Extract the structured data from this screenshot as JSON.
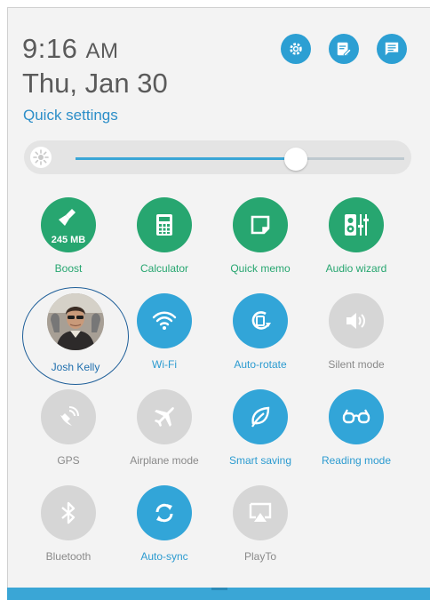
{
  "header": {
    "time": "9:16",
    "ampm": "AM",
    "date": "Thu, Jan 30",
    "quick_settings_label": "Quick settings"
  },
  "top_icons": [
    "gear-icon",
    "edit-icon",
    "message-icon"
  ],
  "brightness": {
    "level_percent": 67
  },
  "tiles": [
    {
      "label": "Boost",
      "sub": "245 MB",
      "state": "on",
      "icon": "broom-icon"
    },
    {
      "label": "Calculator",
      "state": "on",
      "icon": "calculator-icon"
    },
    {
      "label": "Quick memo",
      "state": "on",
      "icon": "memo-icon"
    },
    {
      "label": "Audio wizard",
      "state": "on",
      "icon": "audio-wizard-icon"
    },
    {
      "label": "Josh Kelly",
      "state": "user",
      "icon": "avatar"
    },
    {
      "label": "Wi-Fi",
      "state": "on",
      "icon": "wifi-icon"
    },
    {
      "label": "Auto-rotate",
      "state": "on",
      "icon": "auto-rotate-icon"
    },
    {
      "label": "Silent mode",
      "state": "off",
      "icon": "speaker-icon"
    },
    {
      "label": "GPS",
      "state": "off",
      "icon": "gps-icon"
    },
    {
      "label": "Airplane mode",
      "state": "off",
      "icon": "airplane-icon"
    },
    {
      "label": "Smart saving",
      "state": "on",
      "icon": "leaf-icon"
    },
    {
      "label": "Reading mode",
      "state": "on",
      "icon": "glasses-icon"
    },
    {
      "label": "Bluetooth",
      "state": "off",
      "icon": "bluetooth-icon"
    },
    {
      "label": "Auto-sync",
      "state": "on",
      "icon": "sync-icon"
    },
    {
      "label": "PlayTo",
      "state": "off",
      "icon": "playto-icon"
    }
  ],
  "colors": {
    "accent_blue": "#32a5d8",
    "accent_green": "#27a670",
    "inactive": "#d6d6d6"
  }
}
